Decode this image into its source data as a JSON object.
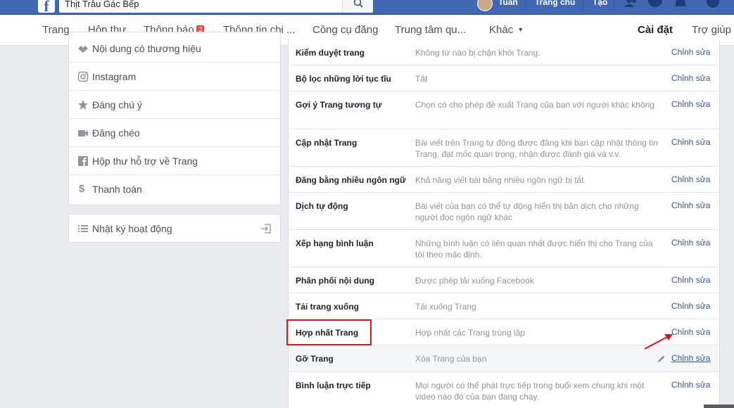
{
  "topbar": {
    "search_value": "Thịt Trâu Gác Bếp",
    "user_name": "Tuấn",
    "home_link": "Trang chủ",
    "create_link": "Tạo"
  },
  "nav": {
    "items": [
      "Trang",
      "Hộp thư",
      "Thông báo",
      "Thông tin chi ...",
      "Công cụ đăng",
      "Trung tâm qu...",
      "Khác",
      "Cài đặt",
      "Trợ giúp"
    ],
    "notification_count": "3",
    "active": "Cài đặt"
  },
  "sidebar": {
    "items": [
      {
        "label": "Nội dung có thương hiệu",
        "icon": "handshake-icon"
      },
      {
        "label": "Instagram",
        "icon": "instagram-icon"
      },
      {
        "label": "Đáng chú ý",
        "icon": "star-icon"
      },
      {
        "label": "Đăng chéo",
        "icon": "video-camera-icon"
      },
      {
        "label": "Hộp thư hỗ trợ về Trang",
        "icon": "facebook-square-icon"
      },
      {
        "label": "Thanh toán",
        "icon": "dollar-icon"
      }
    ],
    "activity_log": "Nhật ký hoạt động"
  },
  "settings": {
    "edit_label": "Chỉnh sửa",
    "rows": [
      {
        "name": "Kiểm duyệt trang",
        "desc": "Không từ nào bị chặn khỏi Trang."
      },
      {
        "name": "Bộ lọc những lời tục tĩu",
        "desc": "Tắt"
      },
      {
        "name": "Gợi ý Trang tương tự",
        "desc": "Chọn có cho phép đề xuất Trang của bạn với người khác không"
      },
      {
        "name": "Cập nhật Trang",
        "desc": "Bài viết trên Trang tự động được đăng khi bạn cập nhật thông tin Trang, đạt mốc quan trọng, nhận được đánh giá và v.v."
      },
      {
        "name": "Đăng bằng nhiều ngôn ngữ",
        "desc": "Khả năng viết bài bằng nhiều ngôn ngữ bị tắt"
      },
      {
        "name": "Dịch tự động",
        "desc": "Bài viết của bạn có thể tự động hiển thị bản dịch cho những người đọc ngôn ngữ khác"
      },
      {
        "name": "Xếp hạng bình luận",
        "desc": "Những bình luận có liên quan nhất được hiển thị cho Trang của tôi theo mặc định."
      },
      {
        "name": "Phân phối nội dung",
        "desc": "Được phép tải xuống Facebook"
      },
      {
        "name": "Tải trang xuống",
        "desc": "Tải xuống Trang"
      },
      {
        "name": "Hợp nhất Trang",
        "desc": "Hợp nhất các Trang trùng lặp"
      },
      {
        "name": "Gỡ Trang",
        "desc": "Xóa Trang của bạn"
      },
      {
        "name": "Bình luận trực tiếp",
        "desc": "Mọi người có thể phát trực tiếp trong buổi xem chung khi một video nào đó của bạn đang chạy."
      }
    ]
  },
  "colors": {
    "facebook_blue": "#4267b2",
    "link": "#365899",
    "annotation_red": "#e0141a"
  }
}
